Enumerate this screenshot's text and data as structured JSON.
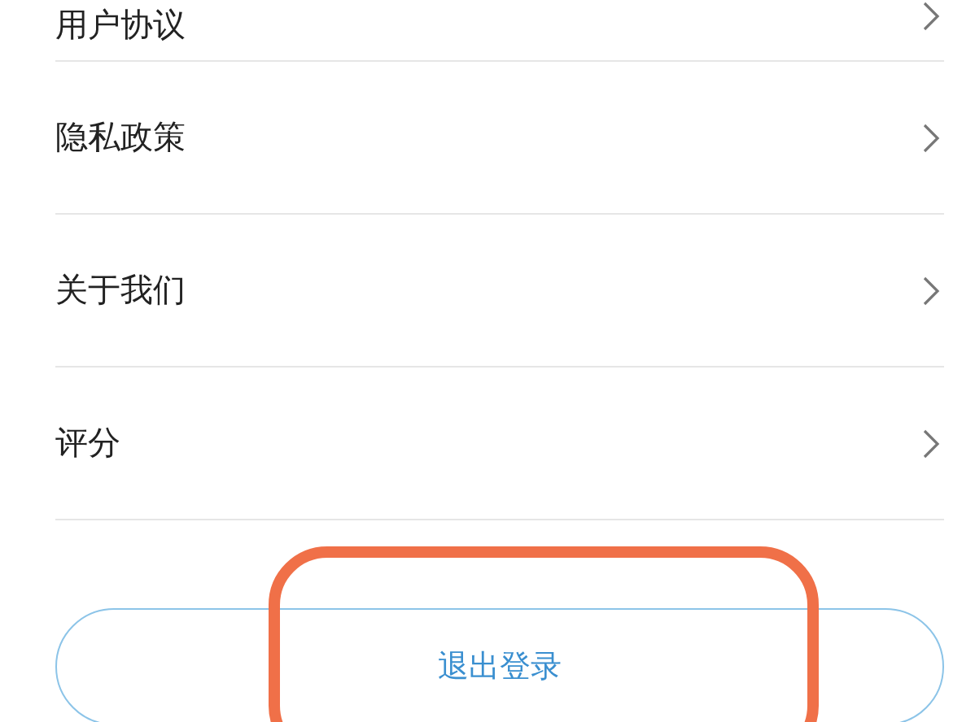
{
  "menu_items": [
    {
      "label": "用户协议"
    },
    {
      "label": "隐私政策"
    },
    {
      "label": "关于我们"
    },
    {
      "label": "评分"
    }
  ],
  "logout_button": {
    "label": "退出登录"
  }
}
